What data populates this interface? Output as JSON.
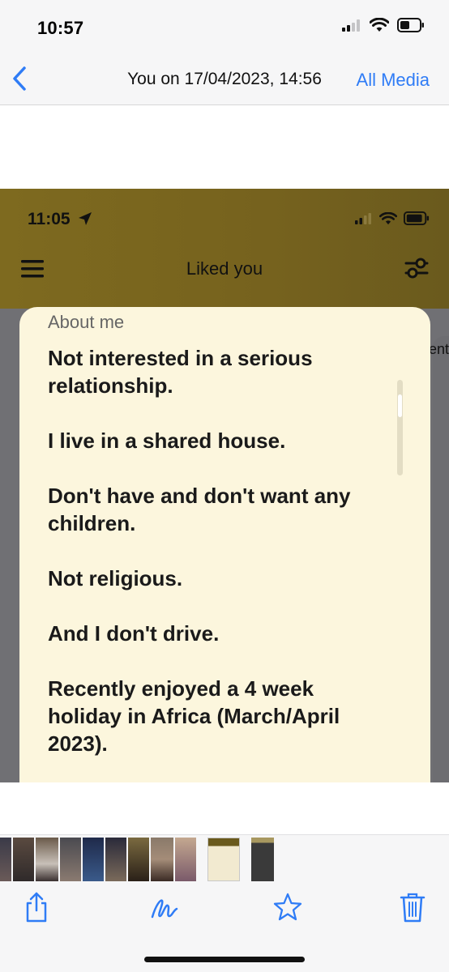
{
  "status_bar": {
    "time": "10:57"
  },
  "nav": {
    "title": "You on 17/04/2023, 14:56",
    "action": "All Media",
    "accent": "#2f7cf6"
  },
  "embedded": {
    "status_time": "11:05",
    "title": "Liked you",
    "right_peek_text": "ent",
    "card": {
      "heading": "About me",
      "paragraphs": [
        "Not interested in a serious relationship.",
        "I live in a shared house.",
        "Don't have and don't want any children.",
        "Not religious.",
        "And I don't drive.",
        "Recently enjoyed a 4 week holiday in Africa (March/April 2023)."
      ]
    }
  },
  "thumbnails": {
    "selected_index": 10
  },
  "toolbar": {
    "icons": [
      "share-icon",
      "markup-icon",
      "favorite-icon",
      "trash-icon"
    ]
  }
}
